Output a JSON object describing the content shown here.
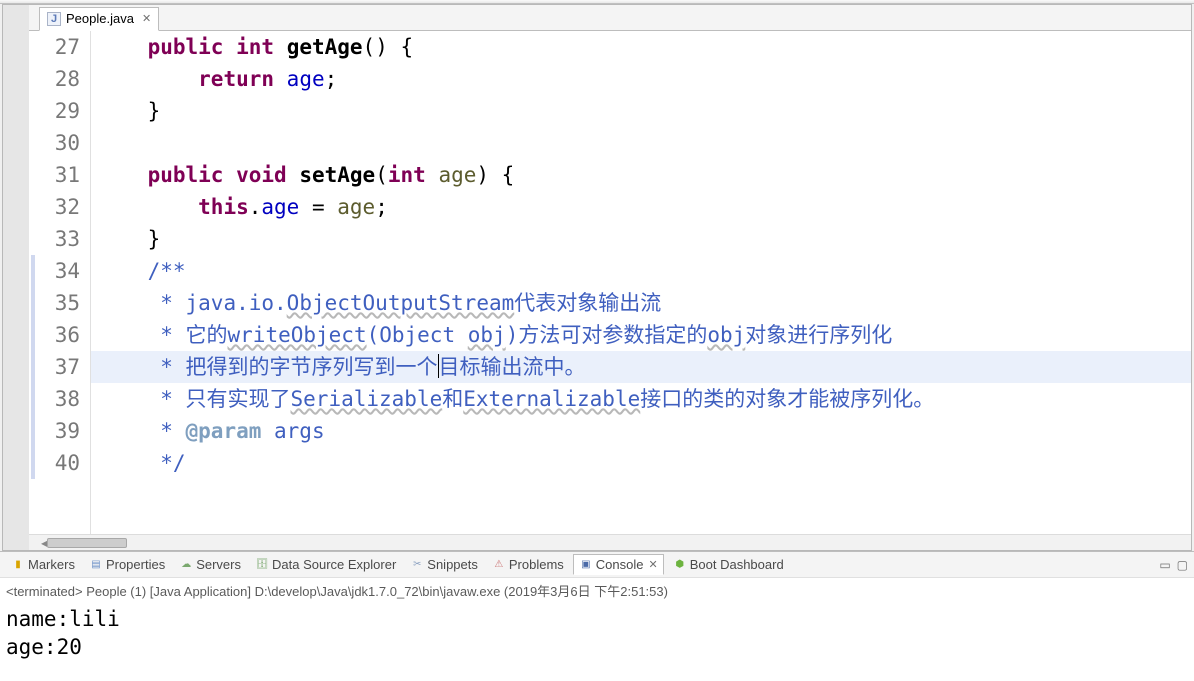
{
  "tab": {
    "filename": "People.java",
    "close": "✕"
  },
  "gutter": [
    "27",
    "28",
    "29",
    "30",
    "31",
    "32",
    "33",
    "34",
    "35",
    "36",
    "37",
    "38",
    "39",
    "40"
  ],
  "code": {
    "l27": {
      "kw1": "public",
      "kw2": "int",
      "fn": "getAge",
      "rest": "() {"
    },
    "l28": {
      "kw": "return",
      "field": "age",
      "semi": ";"
    },
    "l29": "    }",
    "l30": "",
    "l31": {
      "kw1": "public",
      "kw2": "void",
      "fn": "setAge",
      "p1": "(",
      "kw3": "int",
      "param": "age",
      "p2": ") {"
    },
    "l32": {
      "kw": "this",
      "dot": ".",
      "field": "age",
      "eq": " = ",
      "param": "age",
      "semi": ";"
    },
    "l33": "    }",
    "l34": "    /**",
    "l35": {
      "pre": "     * ",
      "text1": "java.io.",
      "link": "ObjectOutputStream",
      "cn": "代表对象输出流"
    },
    "l36": {
      "pre": "     * ",
      "t1": "它的",
      "link1": "writeObject",
      "t2": "(Object ",
      "link2": "obj",
      "t3": ")方法可对参数指定的",
      "link3": "obj",
      "t4": "对象进行序列化"
    },
    "l37a": "     * 把得到的字节序列写到一个",
    "l37b": "目标输出流中。",
    "l38": {
      "pre": "     * 只有实现了",
      "link1": "Serializable",
      "mid": "和",
      "link2": "Externalizable",
      "post": "接口的类的对象才能被序列化。"
    },
    "l39": {
      "pre": "     * ",
      "tag": "@param",
      "arg": " args"
    },
    "l40": "     */"
  },
  "bottomTabs": {
    "markers": "Markers",
    "properties": "Properties",
    "servers": "Servers",
    "dse": "Data Source Explorer",
    "snippets": "Snippets",
    "problems": "Problems",
    "console": "Console",
    "boot": "Boot Dashboard",
    "close": "✕"
  },
  "consoleInfo": "<terminated> People (1) [Java Application] D:\\develop\\Java\\jdk1.7.0_72\\bin\\javaw.exe (2019年3月6日 下午2:51:53)",
  "consoleOut": {
    "l1": "name:lili",
    "l2": "age:20"
  }
}
